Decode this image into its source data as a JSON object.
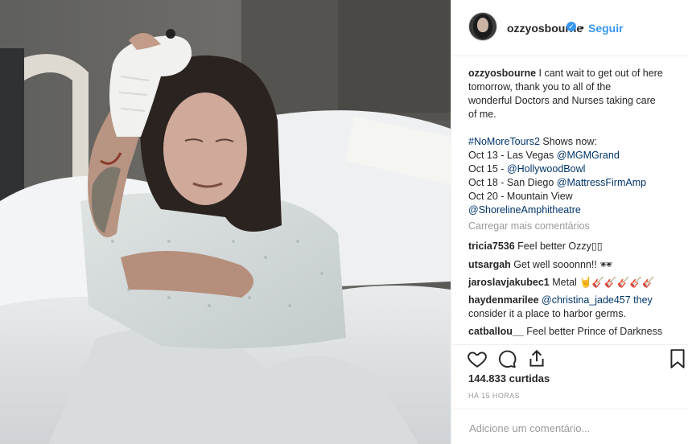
{
  "post": {
    "username": "ozzyosbourne",
    "follow_label": "Seguir",
    "dot": "•",
    "caption": {
      "username": "ozzyosbourne",
      "text_lines": [
        "I cant wait to get out of here",
        "tomorrow, thank you to all of the",
        "wonderful Doctors and Nurses taking care",
        "of me."
      ],
      "hashtag": "#NoMoreTours2",
      "shows_label": "Shows now:",
      "shows": [
        {
          "text": "Oct 13 - Las Vegas ",
          "link": "@MGMGrand"
        },
        {
          "text": "Oct 15 - ",
          "link": "@HollywoodBowl"
        },
        {
          "text": "Oct 18 - San Diego ",
          "link": "@MattressFirmAmp"
        },
        {
          "text": "Oct 20 - Mountain View",
          "link": ""
        }
      ],
      "last_link": "@ShorelineAmphitheatre"
    },
    "load_more": "Carregar mais comentários",
    "comments": [
      {
        "user": "tricia7536",
        "text": "Feel better Ozzy▯▯"
      },
      {
        "user": "utsargah",
        "text": "Get well sooonnn!! 🕶"
      },
      {
        "user": "jaroslavjakubec1",
        "text": "Metal 🤘🎸🎸🎸🎸🎸"
      },
      {
        "user": "haydenmarilee",
        "text": "@christina_jade457 they",
        "text2": "consider it a place to harbor germs."
      },
      {
        "user": "catballou__",
        "text": "Feel better Prince of Darkness"
      }
    ],
    "likes": "144.833 curtidas",
    "time": "HÁ 15 HORAS",
    "add_comment_placeholder": "Adicione um comentário..."
  }
}
